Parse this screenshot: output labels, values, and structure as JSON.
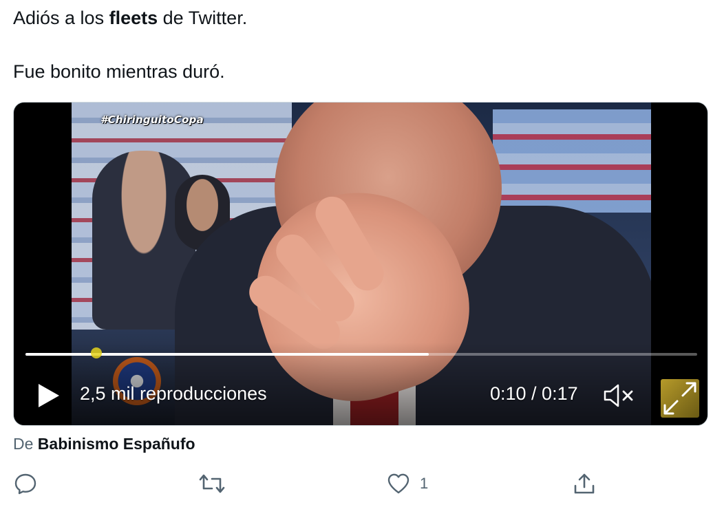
{
  "tweet": {
    "line1_pre": "Adiós a los ",
    "line1_bold": "fleets",
    "line1_post": " de Twitter.",
    "line2": "Fue bonito mientras duró."
  },
  "video": {
    "overlay_hashtag": "#ChiringuitoCopa",
    "views": "2,5 mil reproducciones",
    "time": "0:10 / 0:17",
    "progress_fraction": 0.6,
    "play_icon": "play-icon",
    "mute_icon": "volume-muted-icon",
    "fullscreen_icon": "fullscreen-icon"
  },
  "source": {
    "prefix": "De",
    "author": "Babinismo Españufo"
  },
  "actions": {
    "reply_icon": "reply-icon",
    "retweet_icon": "retweet-icon",
    "like_icon": "heart-icon",
    "like_count": "1",
    "share_icon": "share-icon"
  },
  "colors": {
    "text": "#0f1419",
    "secondary": "#536471",
    "icon": "#536471"
  }
}
